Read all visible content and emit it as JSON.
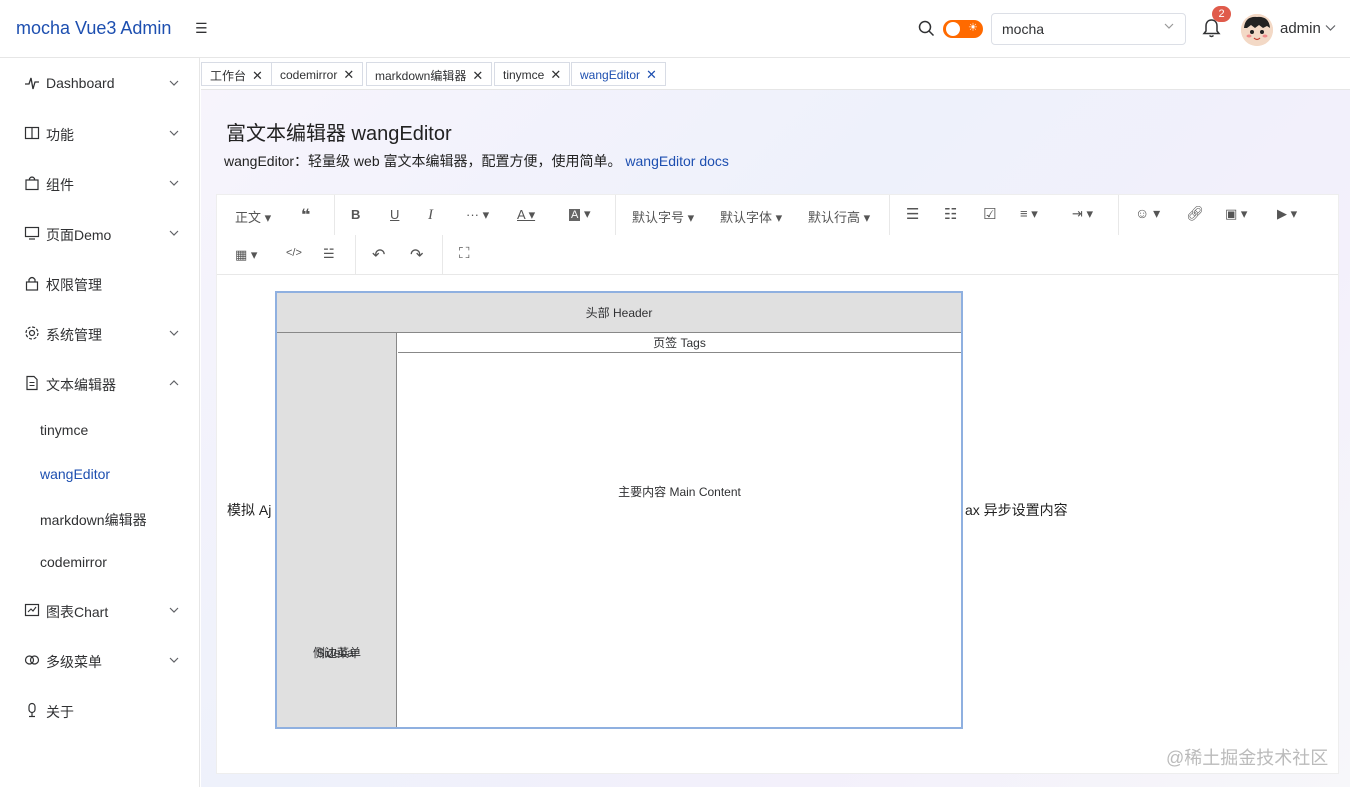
{
  "header": {
    "brand": "mocha Vue3 Admin",
    "collapse_icon": "☰",
    "select_value": "mocha",
    "notification_count": "2",
    "username": "admin",
    "toggle_color": "#ff6a00"
  },
  "sidebar": {
    "items": [
      {
        "label": "Dashboard"
      },
      {
        "label": "功能"
      },
      {
        "label": "组件"
      },
      {
        "label": "页面Demo"
      },
      {
        "label": "权限管理"
      },
      {
        "label": "系统管理"
      },
      {
        "label": "文本编辑器"
      },
      {
        "label": "图表Chart"
      },
      {
        "label": "多级菜单"
      },
      {
        "label": "关于"
      }
    ],
    "sub_items": [
      {
        "label": "tinymce"
      },
      {
        "label": "wangEditor"
      },
      {
        "label": "markdown编辑器"
      },
      {
        "label": "codemirror"
      }
    ]
  },
  "tags": [
    {
      "label": "工作台"
    },
    {
      "label": "codemirror"
    },
    {
      "label": "markdown编辑器"
    },
    {
      "label": "tinymce"
    },
    {
      "label": "wangEditor"
    }
  ],
  "page": {
    "title": "富文本编辑器 wangEditor",
    "desc": "wangEditor：轻量级 web 富文本编辑器，配置方便，使用简单。",
    "docs_link": "wangEditor docs"
  },
  "toolbar": {
    "heading": "正文",
    "font_size": "默认字号",
    "font_family": "默认字体",
    "line_height": "默认行高"
  },
  "editor": {
    "text_left": "模拟 Aj",
    "text_right": "ax 异步设置内容",
    "image": {
      "header": "头部 Header",
      "sidebar_line1": "侧边菜单",
      "sidebar_line2": "Sidebar",
      "tags": "页签 Tags",
      "main": "主要内容 Main Content"
    }
  },
  "watermark": "@稀土掘金技术社区",
  "colors": {
    "accent": "#1d4fb0",
    "badge": "#e05b4b"
  }
}
